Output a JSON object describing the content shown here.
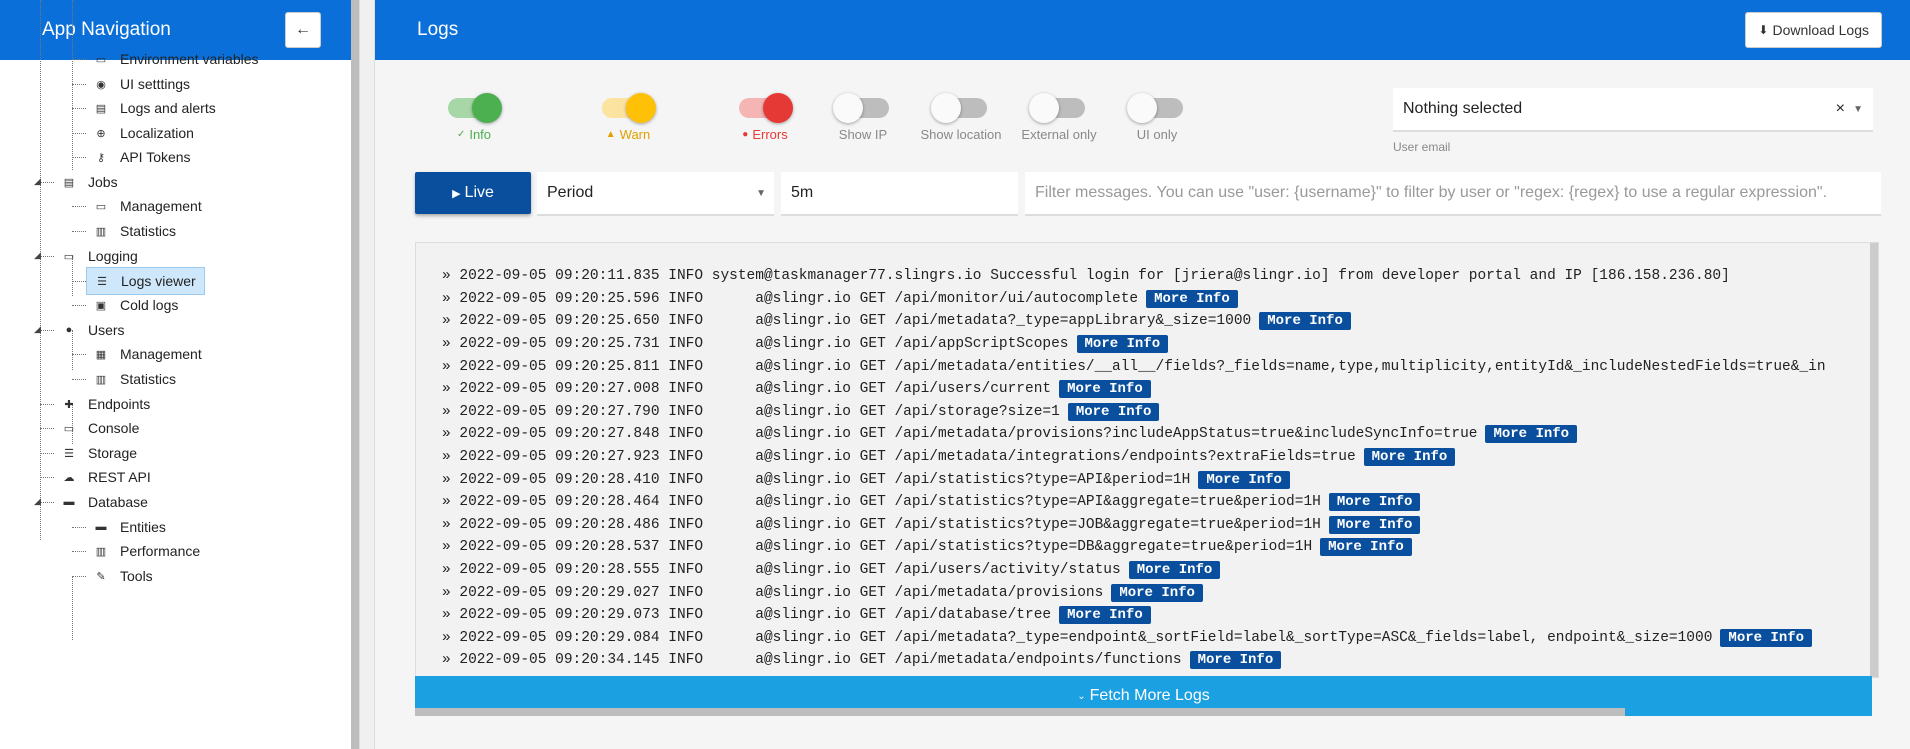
{
  "sidebar": {
    "title": "App Navigation",
    "collapse_icon": "←",
    "items": [
      {
        "label": "Environment variables",
        "icon": "clipboard-icon"
      },
      {
        "label": "UI setttings",
        "icon": "palette-icon"
      },
      {
        "label": "Logs and alerts",
        "icon": "message-icon"
      },
      {
        "label": "Localization",
        "icon": "globe-icon"
      },
      {
        "label": "API Tokens",
        "icon": "key-icon"
      },
      {
        "label": "Jobs",
        "icon": "clipboard-list-icon"
      },
      {
        "label": "Management",
        "icon": "clipboard-icon"
      },
      {
        "label": "Statistics",
        "icon": "bar-chart-icon"
      },
      {
        "label": "Logging",
        "icon": "monitor-icon"
      },
      {
        "label": "Logs viewer",
        "icon": "list-icon"
      },
      {
        "label": "Cold logs",
        "icon": "archive-icon"
      },
      {
        "label": "Users",
        "icon": "user-icon"
      },
      {
        "label": "Management",
        "icon": "id-card-icon"
      },
      {
        "label": "Statistics",
        "icon": "bar-chart-icon"
      },
      {
        "label": "Endpoints",
        "icon": "puzzle-icon"
      },
      {
        "label": "Console",
        "icon": "terminal-icon"
      },
      {
        "label": "Storage",
        "icon": "storage-list-icon"
      },
      {
        "label": "REST API",
        "icon": "cloud-icon"
      },
      {
        "label": "Database",
        "icon": "database-icon"
      },
      {
        "label": "Entities",
        "icon": "folder-icon"
      },
      {
        "label": "Performance",
        "icon": "bar-chart-icon"
      },
      {
        "label": "Tools",
        "icon": "wrench-icon"
      }
    ]
  },
  "header": {
    "title": "Logs",
    "download_label": "Download Logs"
  },
  "toggles": [
    {
      "label": "Info",
      "state": "on",
      "icon": "✓"
    },
    {
      "label": "Warn",
      "state": "on",
      "icon": "▲"
    },
    {
      "label": "Errors",
      "state": "on",
      "icon": "●"
    },
    {
      "label": "Show IP",
      "state": "off"
    },
    {
      "label": "Show location",
      "state": "off"
    },
    {
      "label": "External only",
      "state": "off"
    },
    {
      "label": "UI only",
      "state": "off"
    }
  ],
  "user_email": {
    "value": "Nothing selected",
    "label": "User email",
    "clear": "×",
    "arrow": "▼"
  },
  "filters": {
    "live_label": "Live",
    "period_label": "Period",
    "period_value": "5m",
    "filter_placeholder": "Filter messages. You can use \"user: {username}\" to filter by user or \"regex: {regex} to use a regular expression\"."
  },
  "logs": {
    "more_info_label": "More Info",
    "lines": [
      {
        "text": "» 2022-09-05 09:20:11.835 INFO system@taskmanager77.slingrs.io Successful login for [jriera@slingr.io] from developer portal and IP [186.158.236.80]",
        "more": false
      },
      {
        "text": "» 2022-09-05 09:20:25.596 INFO      a@slingr.io GET /api/monitor/ui/autocomplete",
        "more": true
      },
      {
        "text": "» 2022-09-05 09:20:25.650 INFO      a@slingr.io GET /api/metadata?_type=appLibrary&_size=1000",
        "more": true
      },
      {
        "text": "» 2022-09-05 09:20:25.731 INFO      a@slingr.io GET /api/appScriptScopes",
        "more": true
      },
      {
        "text": "» 2022-09-05 09:20:25.811 INFO      a@slingr.io GET /api/metadata/entities/__all__/fields?_fields=name,type,multiplicity,entityId&_includeNestedFields=true&_in",
        "more": false
      },
      {
        "text": "» 2022-09-05 09:20:27.008 INFO      a@slingr.io GET /api/users/current",
        "more": true
      },
      {
        "text": "» 2022-09-05 09:20:27.790 INFO      a@slingr.io GET /api/storage?size=1",
        "more": true
      },
      {
        "text": "» 2022-09-05 09:20:27.848 INFO      a@slingr.io GET /api/metadata/provisions?includeAppStatus=true&includeSyncInfo=true",
        "more": true
      },
      {
        "text": "» 2022-09-05 09:20:27.923 INFO      a@slingr.io GET /api/metadata/integrations/endpoints?extraFields=true",
        "more": true
      },
      {
        "text": "» 2022-09-05 09:20:28.410 INFO      a@slingr.io GET /api/statistics?type=API&period=1H",
        "more": true
      },
      {
        "text": "» 2022-09-05 09:20:28.464 INFO      a@slingr.io GET /api/statistics?type=API&aggregate=true&period=1H",
        "more": true
      },
      {
        "text": "» 2022-09-05 09:20:28.486 INFO      a@slingr.io GET /api/statistics?type=JOB&aggregate=true&period=1H",
        "more": true
      },
      {
        "text": "» 2022-09-05 09:20:28.537 INFO      a@slingr.io GET /api/statistics?type=DB&aggregate=true&period=1H",
        "more": true
      },
      {
        "text": "» 2022-09-05 09:20:28.555 INFO      a@slingr.io GET /api/users/activity/status",
        "more": true
      },
      {
        "text": "» 2022-09-05 09:20:29.027 INFO      a@slingr.io GET /api/metadata/provisions",
        "more": true
      },
      {
        "text": "» 2022-09-05 09:20:29.073 INFO      a@slingr.io GET /api/database/tree",
        "more": true
      },
      {
        "text": "» 2022-09-05 09:20:29.084 INFO      a@slingr.io GET /api/metadata?_type=endpoint&_sortField=label&_sortType=ASC&_fields=label, endpoint&_size=1000",
        "more": true
      },
      {
        "text": "» 2022-09-05 09:20:34.145 INFO      a@slingr.io GET /api/metadata/endpoints/functions",
        "more": true
      }
    ],
    "fetch_label": "Fetch More Logs"
  },
  "colors": {
    "brand": "#0a6fd8",
    "button_dark": "#0a4f9e",
    "fetch": "#1ba0e2",
    "info": "#4caf50",
    "warn": "#ffc107",
    "error": "#e53935"
  }
}
